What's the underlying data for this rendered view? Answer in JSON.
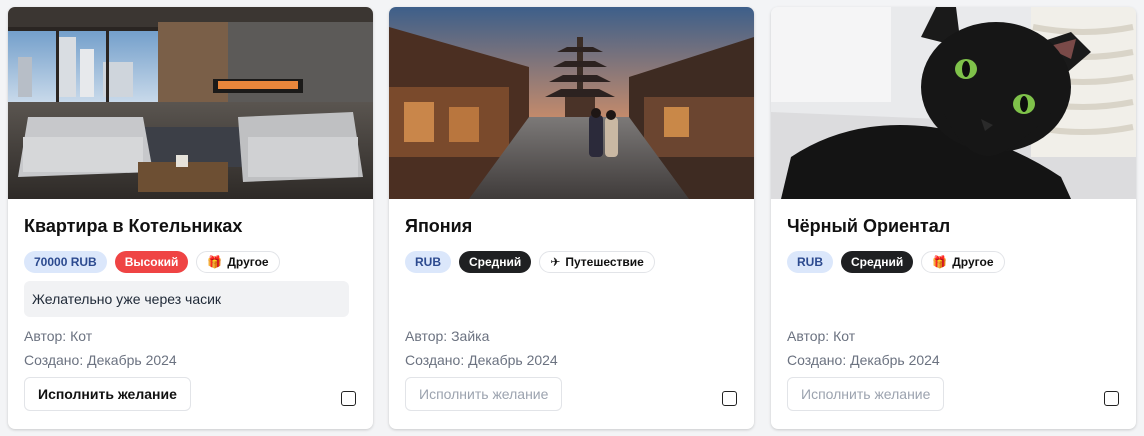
{
  "wishes": [
    {
      "title": "Квартира в Котельниках",
      "price_label": "70000 RUB",
      "priority": "Высокий",
      "category_icon": "gift-icon",
      "category": "Другое",
      "note": "Желательно уже через часик",
      "author": "Автор: Кот",
      "created": "Создано: Декабрь 2024",
      "action_label": "Исполнить желание",
      "action_enabled": true
    },
    {
      "title": "Япония",
      "price_label": "RUB",
      "priority": "Средний",
      "category_icon": "airplane-icon",
      "category": "Путешествие",
      "author": "Автор: Зайка",
      "created": "Создано: Декабрь 2024",
      "action_label": "Исполнить желание",
      "action_enabled": false
    },
    {
      "title": "Чёрный Ориентал",
      "price_label": "RUB",
      "priority": "Средний",
      "category_icon": "gift-icon",
      "category": "Другое",
      "author": "Автор: Кот",
      "created": "Создано: Декабрь 2024",
      "action_label": "Исполнить желание",
      "action_enabled": false
    }
  ],
  "colors": {
    "priority_high": "#ef4444",
    "priority_mid": "#1f2022",
    "price_bg": "#dbe7fb",
    "price_text": "#2c4a8f"
  }
}
